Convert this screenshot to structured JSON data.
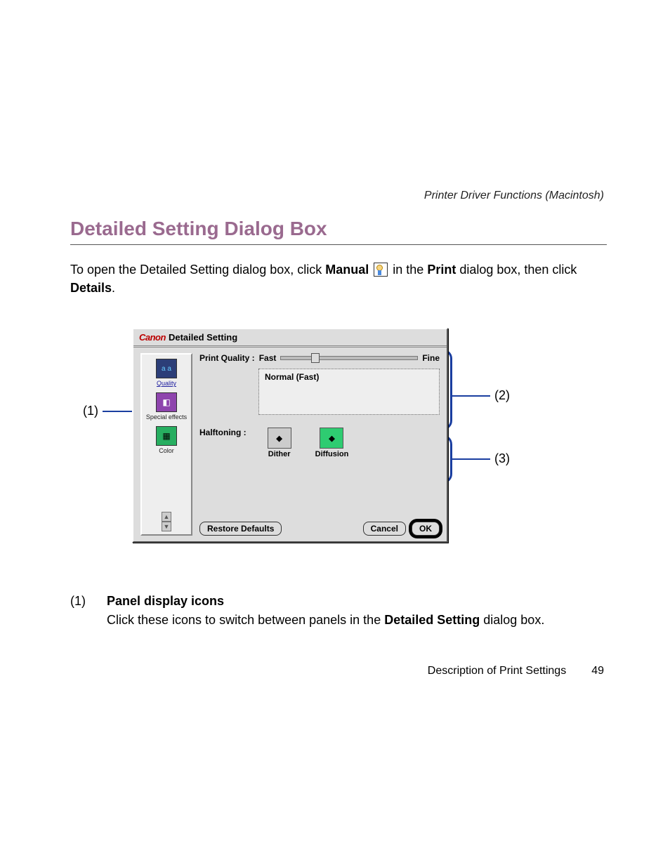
{
  "header": {
    "breadcrumb": "Printer Driver Functions (Macintosh)"
  },
  "title": "Detailed Setting Dialog Box",
  "intro": {
    "prefix": "To open the Detailed Setting dialog box, click ",
    "manual": "Manual",
    "middle_1": " in the ",
    "print": "Print",
    "middle_2": " dialog box, then click ",
    "details": "Details",
    "suffix": "."
  },
  "dialog": {
    "brand": "Canon",
    "title": "Detailed Setting",
    "panels": [
      {
        "label": "Quality",
        "active": true
      },
      {
        "label": "Special effects",
        "active": false
      },
      {
        "label": "Color",
        "active": false
      }
    ],
    "print_quality_label": "Print Quality :",
    "slider_left": "Fast",
    "slider_right": "Fine",
    "status_text": "Normal (Fast)",
    "halftoning_label": "Halftoning :",
    "halftone_options": [
      {
        "label": "Dither",
        "selected": false
      },
      {
        "label": "Diffusion",
        "selected": true
      }
    ],
    "restore_defaults": "Restore Defaults",
    "cancel": "Cancel",
    "ok": "OK"
  },
  "callouts": {
    "c1": "(1)",
    "c2": "(2)",
    "c3": "(3)"
  },
  "descriptions": [
    {
      "num": "(1)",
      "title": "Panel display icons",
      "text_prefix": "Click these icons to switch between panels in the ",
      "text_bold": "Detailed Setting",
      "text_suffix": " dialog box."
    }
  ],
  "footer": {
    "section": "Description of Print Settings",
    "page": "49"
  }
}
